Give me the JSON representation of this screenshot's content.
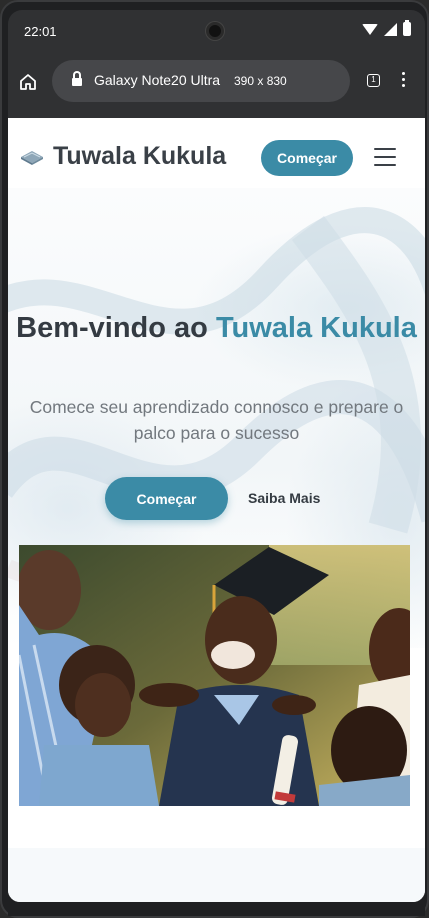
{
  "status_bar": {
    "time": "22:01"
  },
  "browser": {
    "device_name": "Galaxy Note20 Ultra",
    "device_dims": "390 x 830",
    "tab_count": "1"
  },
  "nav": {
    "brand": "Tuwala Kukula",
    "cta_label": "Começar"
  },
  "hero": {
    "title_prefix": "Bem-vindo ao ",
    "title_accent": "Tuwala Kukula",
    "subtitle": "Comece seu aprendizado connosco e prepare o palco para o sucesso",
    "primary_cta": "Começar",
    "secondary_cta": "Saiba Mais"
  },
  "colors": {
    "accent": "#3b8ba6",
    "text_dark": "#343b42",
    "text_muted": "#72787e"
  },
  "icons": {
    "home": "home-icon",
    "lock": "lock-icon",
    "tabs": "tabs-icon",
    "menu": "more-vert-icon",
    "hamburger": "hamburger-icon",
    "logo": "book-icon"
  }
}
